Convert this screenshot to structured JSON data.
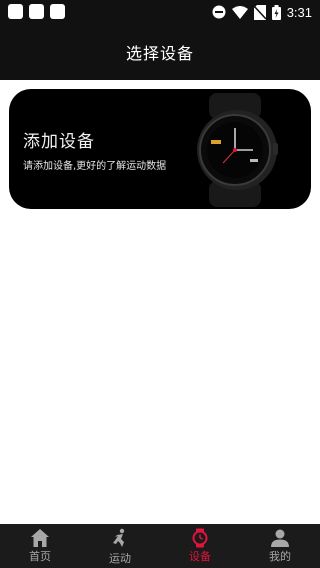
{
  "status_bar": {
    "time": "3:31",
    "icons": [
      "notification-icon",
      "notification-icon",
      "notification-icon",
      "dnd-icon",
      "wifi-icon",
      "no-sim-icon",
      "battery-icon"
    ]
  },
  "header": {
    "title": "选择设备"
  },
  "device_card": {
    "title": "添加设备",
    "subtitle": "请添加设备,更好的了解运动数据",
    "image": "smartwatch"
  },
  "tab_bar": {
    "tabs": [
      {
        "label": "首页",
        "icon": "home-icon",
        "active": false
      },
      {
        "label": "运动",
        "icon": "running-icon",
        "active": false
      },
      {
        "label": "设备",
        "icon": "watch-icon",
        "active": true
      },
      {
        "label": "我的",
        "icon": "profile-icon",
        "active": false
      }
    ]
  },
  "colors": {
    "header_bg": "#111111",
    "card_bg": "#000000",
    "tab_bar_bg": "#1b1b1b",
    "tab_active": "#e0143c",
    "tab_inactive": "#a8a8a8"
  }
}
